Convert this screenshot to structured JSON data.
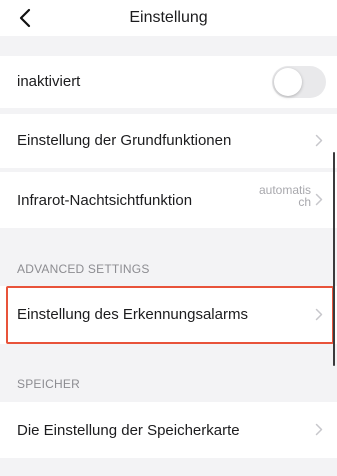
{
  "header": {
    "title": "Einstellung",
    "back_icon": "chevron-left-icon"
  },
  "rows": {
    "inactive": {
      "label": "inaktiviert",
      "toggle_on": false
    },
    "basic_functions": {
      "label": "Einstellung der Grundfunktionen"
    },
    "night_vision": {
      "label": "Infrarot-Nachtsichtfunktion",
      "value": "automatisch"
    }
  },
  "sections": {
    "advanced": {
      "header": "ADVANCED SETTINGS",
      "detection_alarm_label": "Einstellung des Erkennungsalarms"
    },
    "storage": {
      "header": "SPEICHER",
      "memory_card_label": "Die Einstellung der Speicherkarte"
    }
  },
  "colors": {
    "highlight": "#e8533a",
    "background": "#f3f3f5",
    "toggle_off": "#e9e9eb"
  }
}
